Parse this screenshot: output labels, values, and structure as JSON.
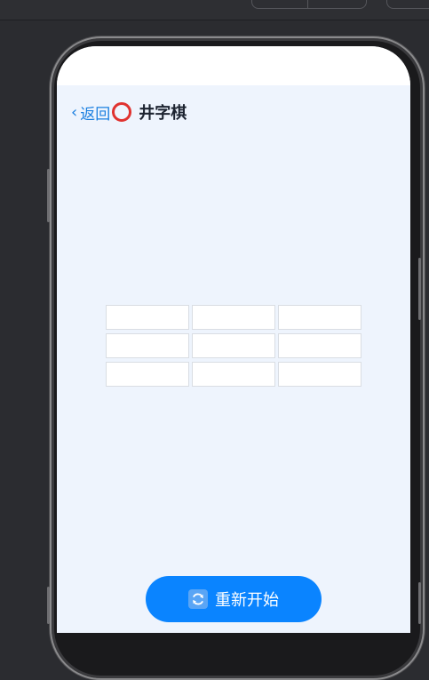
{
  "header": {
    "back_label": "返回",
    "back_chevron": "‹",
    "title": "井字棋",
    "title_icon": "red-circle-icon"
  },
  "board": {
    "cells": [
      "",
      "",
      "",
      "",
      "",
      "",
      "",
      "",
      ""
    ]
  },
  "restart": {
    "label": "重新开始",
    "icon": "refresh-icon"
  },
  "colors": {
    "accent": "#0a84ff",
    "link": "#1a7fe0",
    "background": "#eef4fd",
    "title_ring": "#e0322f"
  }
}
